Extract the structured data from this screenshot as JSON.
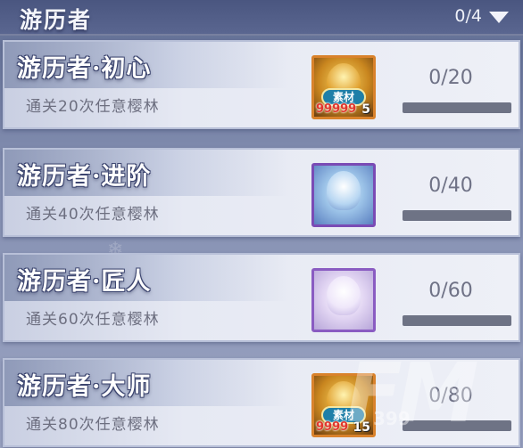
{
  "header": {
    "title": "游历者",
    "count": "0/4",
    "dropdown_icon": "triangle-down-icon"
  },
  "quests": [
    {
      "title": "游历者·初心",
      "description": "通关20次任意樱林",
      "progress_text": "0/20",
      "progress_fraction": 0,
      "reward": {
        "style": "gold",
        "tag": "素材",
        "amount": "99999",
        "count": "5"
      }
    },
    {
      "title": "游历者·进阶",
      "description": "通关40次任意樱林",
      "progress_text": "0/40",
      "progress_fraction": 0,
      "reward": {
        "style": "blue",
        "tag": "",
        "amount": "",
        "count": ""
      }
    },
    {
      "title": "游历者·匠人",
      "description": "通关60次任意樱林",
      "progress_text": "0/60",
      "progress_fraction": 0,
      "reward": {
        "style": "lilac",
        "tag": "",
        "amount": "",
        "count": ""
      }
    },
    {
      "title": "游历者·大师",
      "description": "通关80次任意樱林",
      "progress_text": "0/80",
      "progress_fraction": 0,
      "reward": {
        "style": "gold",
        "tag": "素材",
        "amount": "9999",
        "count": "15"
      }
    }
  ],
  "watermark": {
    "logo": "FM",
    "sub": "399"
  },
  "colors": {
    "header_bg": "#4a5680",
    "card_bg": "#eef0f7",
    "progress_track": "#6e7385",
    "reward_amount": "#e2352b"
  }
}
